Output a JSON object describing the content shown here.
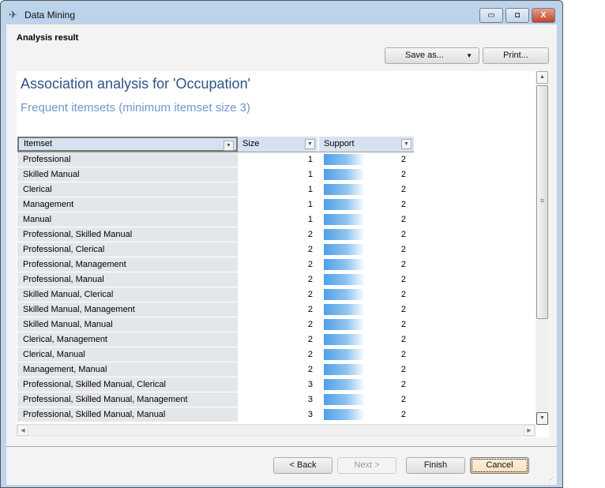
{
  "window": {
    "title": "Data Mining",
    "minimize": "▭",
    "maximize": "◘",
    "close": "X"
  },
  "heading": "Analysis result",
  "toolbar": {
    "save_as": "Save as...",
    "print": "Print..."
  },
  "report": {
    "title": "Association analysis for 'Occupation'",
    "subtitle": "Frequent itemsets (minimum itemset size 3)"
  },
  "table": {
    "columns": [
      "Itemset",
      "Size",
      "Support"
    ],
    "rows": [
      [
        "Professional",
        "1",
        "2"
      ],
      [
        "Skilled Manual",
        "1",
        "2"
      ],
      [
        "Clerical",
        "1",
        "2"
      ],
      [
        "Management",
        "1",
        "2"
      ],
      [
        "Manual",
        "1",
        "2"
      ],
      [
        "Professional, Skilled Manual",
        "2",
        "2"
      ],
      [
        "Professional, Clerical",
        "2",
        "2"
      ],
      [
        "Professional, Management",
        "2",
        "2"
      ],
      [
        "Professional, Manual",
        "2",
        "2"
      ],
      [
        "Skilled Manual, Clerical",
        "2",
        "2"
      ],
      [
        "Skilled Manual, Management",
        "2",
        "2"
      ],
      [
        "Skilled Manual, Manual",
        "2",
        "2"
      ],
      [
        "Clerical, Management",
        "2",
        "2"
      ],
      [
        "Clerical, Manual",
        "2",
        "2"
      ],
      [
        "Management, Manual",
        "2",
        "2"
      ],
      [
        "Professional, Skilled Manual, Clerical",
        "3",
        "2"
      ],
      [
        "Professional, Skilled Manual, Management",
        "3",
        "2"
      ],
      [
        "Professional, Skilled Manual, Manual",
        "3",
        "2"
      ]
    ]
  },
  "footer": {
    "back": "< Back",
    "next": "Next >",
    "finish": "Finish",
    "cancel": "Cancel"
  }
}
